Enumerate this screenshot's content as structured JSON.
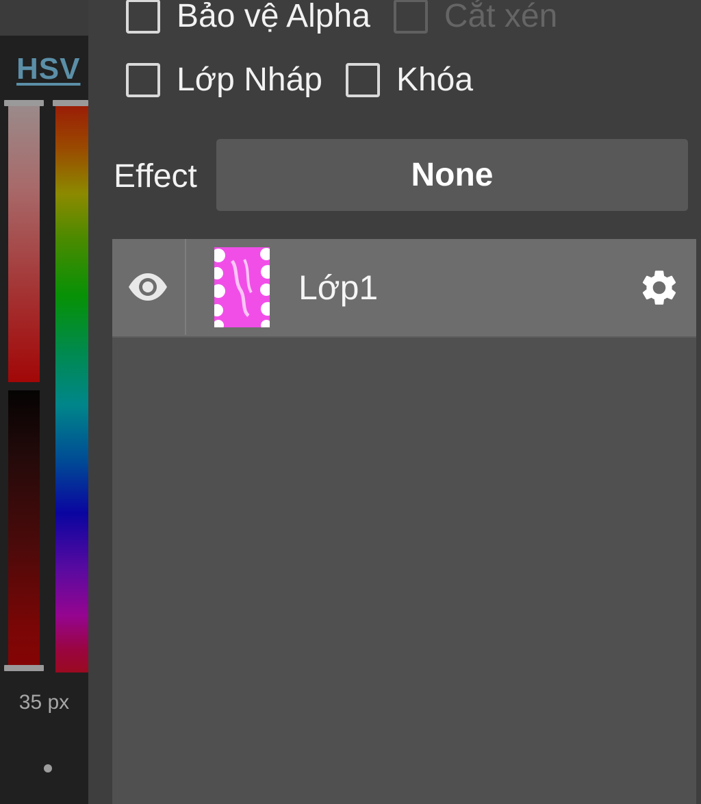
{
  "color_panel": {
    "mode_label": "HSV",
    "brush_size": "35 px",
    "slider_colors": {
      "saturation_top": "#9a8b8b",
      "saturation_bottom": "#a20707",
      "value_top": "#050303",
      "value_bottom": "#850404"
    }
  },
  "layer_options": {
    "alpha_protect_label": "Bảo vệ Alpha",
    "clipping_label": "Cắt xén",
    "draft_layer_label": "Lớp Nháp",
    "lock_label": "Khóa"
  },
  "effect": {
    "label": "Effect",
    "value": "None"
  },
  "layers": [
    {
      "name": "Lớp1",
      "visible": true,
      "thumbnail_color": "#f14ee8",
      "icons": [
        "eye-icon",
        "gear-icon"
      ]
    }
  ]
}
